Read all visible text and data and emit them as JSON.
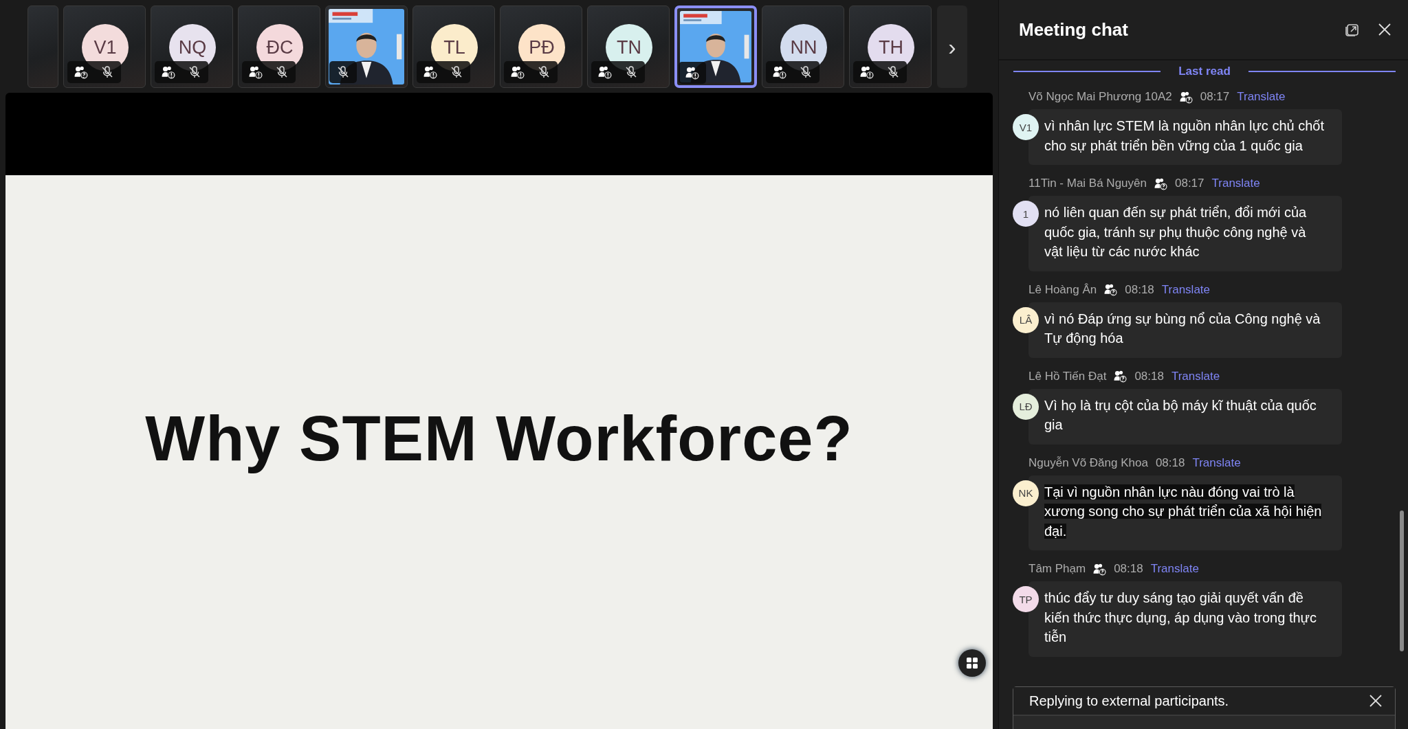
{
  "participants": [
    {
      "kind": "blank"
    },
    {
      "kind": "avatar",
      "initials": "V1",
      "color": "#f3dcdc",
      "external": true,
      "unverified": true,
      "muted": true,
      "selected": false
    },
    {
      "kind": "avatar",
      "initials": "NQ",
      "color": "#e7e2ee",
      "external": true,
      "unverified": false,
      "muted": true,
      "selected": false
    },
    {
      "kind": "avatar",
      "initials": "ĐC",
      "color": "#f4d9dc",
      "external": true,
      "unverified": false,
      "muted": true,
      "selected": false
    },
    {
      "kind": "video",
      "external": false,
      "muted": true,
      "selected": false
    },
    {
      "kind": "avatar",
      "initials": "TL",
      "color": "#fbeccb",
      "external": true,
      "unverified": false,
      "muted": true,
      "selected": false
    },
    {
      "kind": "avatar",
      "initials": "PĐ",
      "color": "#fde3c8",
      "external": true,
      "unverified": false,
      "muted": true,
      "selected": false
    },
    {
      "kind": "avatar",
      "initials": "TN",
      "color": "#d8f0ee",
      "external": true,
      "unverified": false,
      "muted": true,
      "selected": false
    },
    {
      "kind": "video",
      "external": true,
      "unverified": false,
      "muted": false,
      "selected": true
    },
    {
      "kind": "avatar",
      "initials": "NN",
      "color": "#d3dcee",
      "external": true,
      "unverified": false,
      "muted": true,
      "selected": false
    },
    {
      "kind": "avatar",
      "initials": "TH",
      "color": "#e3dcee",
      "external": true,
      "unverified": false,
      "muted": true,
      "selected": false
    }
  ],
  "next_button": "›",
  "slide": {
    "title": "Why STEM Workforce?"
  },
  "chat": {
    "title": "Meeting chat",
    "last_read": "Last read",
    "messages": [
      {
        "sender": "Võ Ngọc Mai Phương 10A2",
        "external": true,
        "time": "08:17",
        "translate": "Translate",
        "initials": "V1",
        "color": "#dff3f2",
        "text": "vì nhân lực STEM là nguồn nhân lực chủ chốt cho sự phát triển bền vững của 1 quốc gia",
        "highlighted": false
      },
      {
        "sender": "11Tin - Mai Bá Nguyên",
        "external": true,
        "time": "08:17",
        "translate": "Translate",
        "initials": "1",
        "color": "#e2e0f3",
        "text": "nó liên quan đến sự phát triển, đổi mới của quốc gia, tránh sự phụ thuộc công nghệ và vật liệu từ các nước khác",
        "highlighted": false
      },
      {
        "sender": "Lê Hoàng Ân",
        "external": true,
        "time": "08:18",
        "translate": "Translate",
        "initials": "LÂ",
        "color": "#fbefcf",
        "text": "vì nó Đáp ứng sự bùng nổ của Công nghệ và Tự động hóa",
        "highlighted": false
      },
      {
        "sender": "Lê Hồ Tiến Đạt",
        "external": true,
        "time": "08:18",
        "translate": "Translate",
        "initials": "LĐ",
        "color": "#e5eedc",
        "text": "Vì họ là trụ cột của bộ máy kĩ thuật của quốc gia",
        "highlighted": false
      },
      {
        "sender": "Nguyễn Võ Đăng Khoa",
        "external": false,
        "time": "08:18",
        "translate": "Translate",
        "initials": "NK",
        "color": "#fbefcf",
        "text": "Tại vì nguồn nhân lực nàu đóng vai trò là xương song cho sự phát triển của xã hội hiện đại.",
        "highlighted": true
      },
      {
        "sender": "Tâm Phạm",
        "external": true,
        "time": "08:18",
        "translate": "Translate",
        "initials": "TP",
        "color": "#f3dbe9",
        "text": "thúc đẩy tư duy sáng tạo giải quyết vấn đề kiến thức thực dụng, áp dụng vào trong thực tiễn",
        "highlighted": false
      }
    ],
    "reply_notice": "Replying to external participants."
  }
}
